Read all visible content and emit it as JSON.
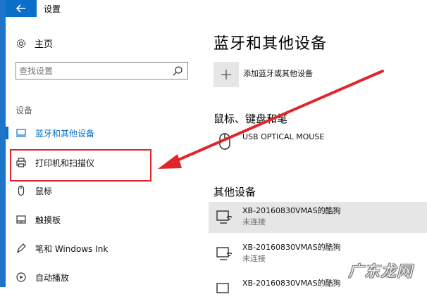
{
  "window": {
    "title": "设置"
  },
  "nav": {
    "home_label": "主页",
    "search_placeholder": "查找设置",
    "section_label": "设备",
    "items": [
      {
        "label": "蓝牙和其他设备",
        "icon": "bluetooth-devices-icon",
        "selected": true
      },
      {
        "label": "打印机和扫描仪",
        "icon": "printer-icon",
        "selected": false
      },
      {
        "label": "鼠标",
        "icon": "mouse-icon",
        "selected": false
      },
      {
        "label": "触摸板",
        "icon": "touchpad-icon",
        "selected": false
      },
      {
        "label": "笔和 Windows Ink",
        "icon": "pen-icon",
        "selected": false
      },
      {
        "label": "自动播放",
        "icon": "autoplay-icon",
        "selected": false
      }
    ]
  },
  "main": {
    "title": "蓝牙和其他设备",
    "add_device_label": "添加蓝牙或其他设备",
    "mouse_section_title": "鼠标、键盘和笔",
    "mouse_device": "USB OPTICAL MOUSE",
    "other_section_title": "其他设备",
    "other_devices": [
      {
        "name": "XB-20160830VMAS的酷狗",
        "status": "未连接"
      },
      {
        "name": "XB-20160830VMAS的酷狗",
        "status": "未连接"
      },
      {
        "name": "XB-20160830VMAS的酷狗",
        "status": ""
      }
    ]
  },
  "watermark": "广东龙网",
  "colors": {
    "accent": "#0a6fc8",
    "frame": "#1e74c8",
    "annotation": "#e0262b",
    "selected_row": "#e6e6e6"
  }
}
